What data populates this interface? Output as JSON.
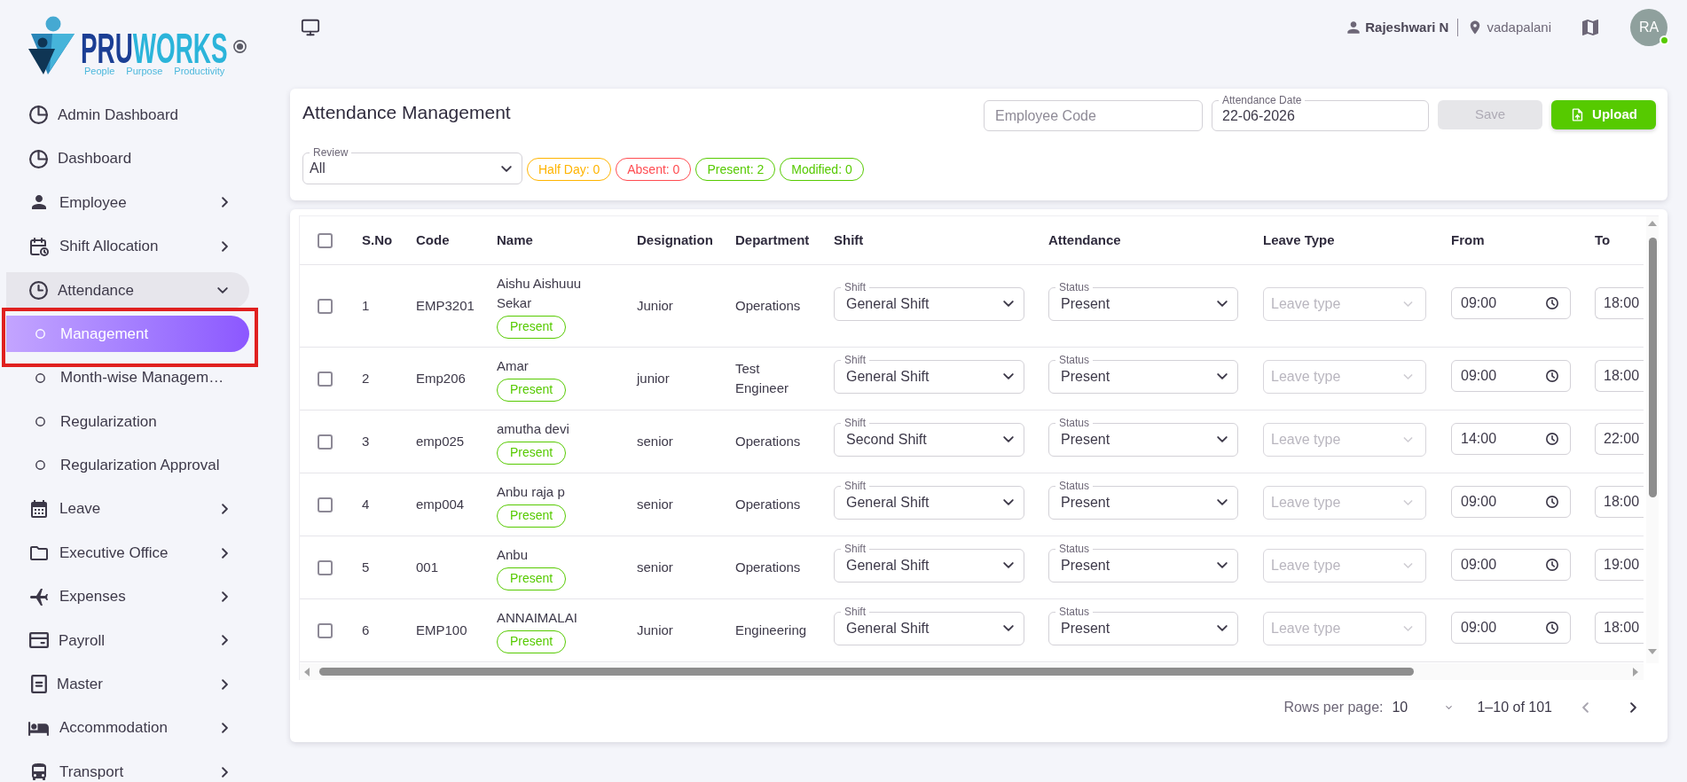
{
  "logo": {
    "wordmark": [
      {
        "text": "PRU",
        "color": "#1b3e94"
      },
      {
        "text": "WORKS",
        "color": "#2bb4da"
      }
    ],
    "tagline": "People Purpose Productivity"
  },
  "sidebar": {
    "items": [
      {
        "label": "Admin Dashboard",
        "selected": false
      },
      {
        "label": "Dashboard",
        "selected": false
      },
      {
        "label": "Employee",
        "selected": false,
        "expanded": false
      },
      {
        "label": "Shift Allocation",
        "selected": false,
        "expanded": false
      },
      {
        "label": "Attendance",
        "selected": false,
        "expanded": true,
        "children": [
          {
            "label": "Management",
            "selected": true,
            "annotated": true
          },
          {
            "label": "Month-wise Managem…",
            "selected": false,
            "annotated": false
          },
          {
            "label": "Regularization",
            "selected": false,
            "annotated": false
          },
          {
            "label": "Regularization Approval",
            "selected": false,
            "annotated": false
          }
        ]
      },
      {
        "label": "Leave",
        "selected": false,
        "expanded": false
      },
      {
        "label": "Executive Office",
        "selected": false,
        "expanded": false
      },
      {
        "label": "Expenses",
        "selected": false,
        "expanded": false
      },
      {
        "label": "Payroll",
        "selected": false,
        "expanded": false
      },
      {
        "label": "Master",
        "selected": false,
        "expanded": false
      },
      {
        "label": "Accommodation",
        "selected": false,
        "expanded": false
      },
      {
        "label": "Transport",
        "selected": false,
        "expanded": false
      }
    ]
  },
  "header": {
    "user_name": "Rajeshwari N",
    "location": "vadapalani",
    "avatar_initials": "RA",
    "online": true
  },
  "attendance_panel": {
    "title": "Attendance Management",
    "employee_code": {
      "placeholder": "Employee Code"
    },
    "attendance_date": {
      "label": "Attendance Date",
      "value": "22-06-2026"
    },
    "buttons": [
      {
        "label": "Save",
        "kind": "text",
        "disabled": true
      },
      {
        "label": "Upload",
        "kind": "upload",
        "disabled": false
      }
    ],
    "review": {
      "label": "Review",
      "value": "All"
    },
    "counters": [
      {
        "label": "Half Day: 0",
        "color": "#ffb400"
      },
      {
        "label": "Absent: 0",
        "color": "#ff4c51"
      },
      {
        "label": "Present: 2",
        "color": "#56ca00"
      },
      {
        "label": "Modified: 0",
        "color": "#56ca00"
      }
    ]
  },
  "table": {
    "select_all": {
      "checked": false
    },
    "columns": [
      "S.No",
      "Code",
      "Name",
      "Designation",
      "Department",
      "Shift",
      "Attendance",
      "Leave Type",
      "From",
      "To"
    ],
    "rows": [
      {
        "checked": false,
        "sno": "1",
        "code": "EMP3201",
        "name": "Aishu Aishuuu Sekar",
        "badge": "Present",
        "designation": "Junior",
        "department": "Operations",
        "shift": {
          "label": "Shift",
          "value": "General Shift"
        },
        "status": {
          "label": "Status",
          "value": "Present"
        },
        "leave_type": {
          "placeholder": "Leave type",
          "disabled": true
        },
        "from": "09:00",
        "to": "18:00"
      },
      {
        "checked": false,
        "sno": "2",
        "code": "Emp206",
        "name": "Amar",
        "badge": "Present",
        "designation": "junior",
        "department": "Test Engineer",
        "shift": {
          "label": "Shift",
          "value": "General Shift"
        },
        "status": {
          "label": "Status",
          "value": "Present"
        },
        "leave_type": {
          "placeholder": "Leave type",
          "disabled": true
        },
        "from": "09:00",
        "to": "18:00"
      },
      {
        "checked": false,
        "sno": "3",
        "code": "emp025",
        "name": "amutha devi",
        "badge": "Present",
        "designation": "senior",
        "department": "Operations",
        "shift": {
          "label": "Shift",
          "value": "Second Shift"
        },
        "status": {
          "label": "Status",
          "value": "Present"
        },
        "leave_type": {
          "placeholder": "Leave type",
          "disabled": true
        },
        "from": "14:00",
        "to": "22:00"
      },
      {
        "checked": false,
        "sno": "4",
        "code": "emp004",
        "name": "Anbu raja p",
        "badge": "Present",
        "designation": "senior",
        "department": "Operations",
        "shift": {
          "label": "Shift",
          "value": "General Shift"
        },
        "status": {
          "label": "Status",
          "value": "Present"
        },
        "leave_type": {
          "placeholder": "Leave type",
          "disabled": true
        },
        "from": "09:00",
        "to": "18:00"
      },
      {
        "checked": false,
        "sno": "5",
        "code": "001",
        "name": "Anbu",
        "badge": "Present",
        "designation": "senior",
        "department": "Operations",
        "shift": {
          "label": "Shift",
          "value": "General Shift"
        },
        "status": {
          "label": "Status",
          "value": "Present"
        },
        "leave_type": {
          "placeholder": "Leave type",
          "disabled": true
        },
        "from": "09:00",
        "to": "19:00"
      },
      {
        "checked": false,
        "sno": "6",
        "code": "EMP100",
        "name": "ANNAIMALAI",
        "badge": "Present",
        "designation": "Junior",
        "department": "Engineering",
        "shift": {
          "label": "Shift",
          "value": "General Shift"
        },
        "status": {
          "label": "Status",
          "value": "Present"
        },
        "leave_type": {
          "placeholder": "Leave type",
          "disabled": true
        },
        "from": "09:00",
        "to": "18:00"
      }
    ]
  },
  "pagination": {
    "rows_per_page_label": "Rows per page:",
    "rows_per_page": "10",
    "range": "1–10 of 101",
    "previous": {
      "disabled": true
    },
    "next": {
      "disabled": false
    }
  }
}
